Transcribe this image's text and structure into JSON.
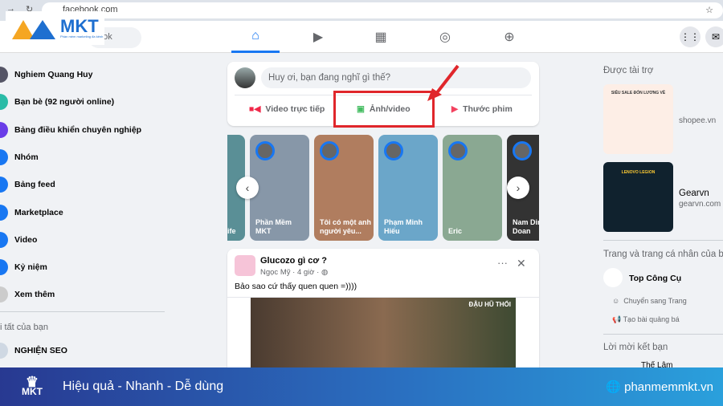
{
  "browser": {
    "url": "facebook.com"
  },
  "header": {
    "search_placeholder": "ook",
    "nav": [
      "home",
      "watch",
      "marketplace",
      "groups",
      "gaming"
    ]
  },
  "brand": {
    "logo_text": "MKT",
    "logo_sub": "Phần mềm marketing đa kênh"
  },
  "sidebar": {
    "items": [
      {
        "label": "Nghiem Quang Huy",
        "icon": "avatar"
      },
      {
        "label": "Bạn bè (92 người online)",
        "icon": "friends-icon",
        "color": "#2abba7"
      },
      {
        "label": "Bảng điều khiển chuyên nghiệp",
        "icon": "dashboard-icon",
        "color": "#6a3de8"
      },
      {
        "label": "Nhóm",
        "icon": "groups-icon",
        "color": "#1877f2"
      },
      {
        "label": "Bảng feed",
        "icon": "feed-icon",
        "color": "#1877f2"
      },
      {
        "label": "Marketplace",
        "icon": "marketplace-icon",
        "color": "#1877f2"
      },
      {
        "label": "Video",
        "icon": "video-icon",
        "color": "#1877f2"
      },
      {
        "label": "Kỷ niệm",
        "icon": "memories-icon",
        "color": "#1877f2"
      },
      {
        "label": "Xem thêm",
        "icon": "chevron-down-icon",
        "color": "#ccc"
      }
    ],
    "shortcuts_title": "i tất của bạn",
    "shortcut": "NGHIỆN SEO"
  },
  "composer": {
    "placeholder": "Huy ơi, bạn đang nghĩ gì thế?",
    "actions": [
      "Video trực tiếp",
      "Ảnh/video",
      "Thước phim"
    ],
    "highlight_color": "#e0262b"
  },
  "stories": [
    {
      "label": "ife",
      "color": "#5a8f96"
    },
    {
      "label": "Phần Mềm MKT",
      "color": "#8797a8"
    },
    {
      "label": "Tôi có một anh người yêu...",
      "color": "#b07d5f"
    },
    {
      "label": "Phạm Minh Hiếu",
      "color": "#6ba6c9"
    },
    {
      "label": "Eric",
      "color": "#8aa892"
    },
    {
      "label": "Nam Dinh Doan",
      "color": "#333"
    }
  ],
  "post": {
    "title": "Glucozo gì cơ ?",
    "author": "Ngọc Mỹ",
    "time": "4 giờ",
    "text": "Bảo sao cứ thấy quen quen =))))",
    "image_caption": "ĐẬU HŨ THỐI"
  },
  "right": {
    "sponsored": "Được tài trợ",
    "ads": [
      {
        "title": "",
        "site": "shopee.vn",
        "banner": "SIÊU SALE ĐÓN LƯƠNG VỀ"
      },
      {
        "title": "Gearvn",
        "site": "gearvn.com",
        "banner": "LENOVO LEGION"
      }
    ],
    "pages_title": "Trang và trang cá nhân của ba",
    "page_name": "Top Công Cụ",
    "page_actions": [
      "Chuyển sang Trang",
      "Tạo bài quảng bá"
    ],
    "friend_requests": "Lời mời kết bạn",
    "friend": "Thế Lâm"
  },
  "footer": {
    "slogan": "Hiệu quả - Nhanh  - Dễ dùng",
    "site": "phanmemmkt.vn",
    "logo": "MKT"
  }
}
